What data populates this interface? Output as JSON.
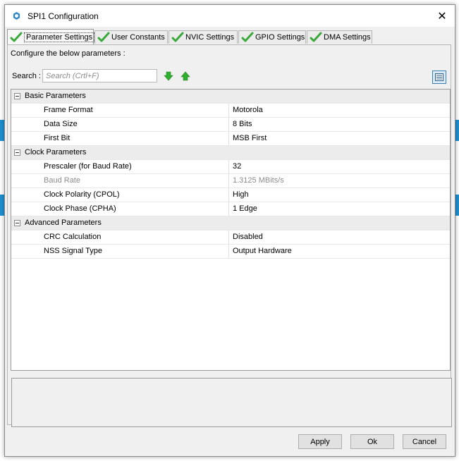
{
  "window": {
    "title": "SPI1 Configuration",
    "close_glyph": "✕"
  },
  "tabs": [
    {
      "label": "Parameter Settings",
      "icon": "check-icon",
      "active": true
    },
    {
      "label": "User Constants",
      "icon": "check-icon"
    },
    {
      "label": "NVIC Settings",
      "icon": "check-icon"
    },
    {
      "label": "GPIO Settings",
      "icon": "check-icon"
    },
    {
      "label": "DMA Settings",
      "icon": "check-icon"
    }
  ],
  "panel": {
    "instruction": "Configure the below parameters :",
    "search_label": "Search :",
    "search_placeholder": "Search (Crtl+F)",
    "search_value": ""
  },
  "groups": [
    {
      "name": "Basic Parameters",
      "params": [
        {
          "name": "Frame Format",
          "value": "Motorola"
        },
        {
          "name": "Data Size",
          "value": "8 Bits"
        },
        {
          "name": "First Bit",
          "value": "MSB First"
        }
      ]
    },
    {
      "name": "Clock Parameters",
      "params": [
        {
          "name": "Prescaler (for Baud Rate)",
          "value": "32"
        },
        {
          "name": "Baud Rate",
          "value": "1.3125 MBits/s",
          "disabled": true
        },
        {
          "name": "Clock Polarity (CPOL)",
          "value": "High"
        },
        {
          "name": "Clock Phase (CPHA)",
          "value": "1 Edge"
        }
      ]
    },
    {
      "name": "Advanced Parameters",
      "params": [
        {
          "name": "CRC Calculation",
          "value": "Disabled"
        },
        {
          "name": "NSS Signal Type",
          "value": "Output Hardware"
        }
      ]
    }
  ],
  "buttons": {
    "apply": "Apply",
    "ok": "Ok",
    "cancel": "Cancel"
  },
  "colors": {
    "check_green": "#3aa83a",
    "arrow_green": "#2fb02f",
    "accent_blue": "#1e8fd0"
  }
}
